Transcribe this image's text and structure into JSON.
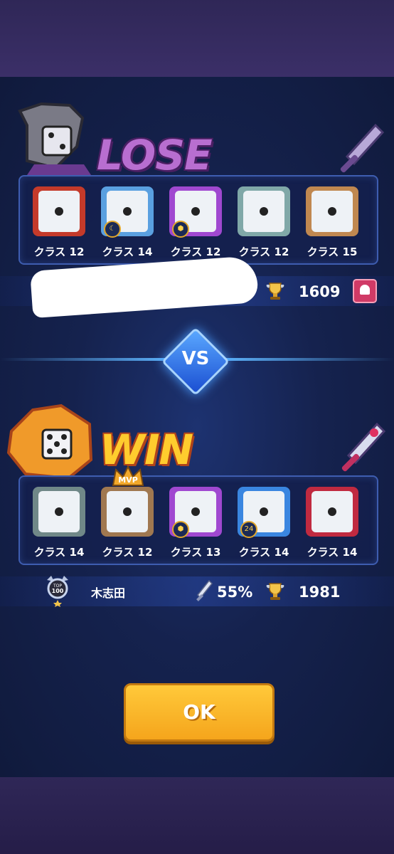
{
  "lose": {
    "banner": "LOSE",
    "dice": [
      {
        "label": "クラス 12",
        "icon": "sword-dice-icon",
        "color": "#c43a2a",
        "badge": ""
      },
      {
        "label": "クラス 14",
        "icon": "wind-dice-icon",
        "color": "#5aa0e0",
        "badge": "moon"
      },
      {
        "label": "クラス 12",
        "icon": "ring-dice-icon",
        "color": "#a048d0",
        "badge": "hex"
      },
      {
        "label": "クラス 12",
        "icon": "paper-dice-icon",
        "color": "#80a8a8",
        "badge": ""
      },
      {
        "label": "クラス 15",
        "icon": "mystery-dice-icon",
        "color": "#c08850",
        "badge": ""
      }
    ],
    "trophies": "1609"
  },
  "vs": "VS",
  "win": {
    "banner": "WIN",
    "mvp": "MVP",
    "dice": [
      {
        "label": "クラス 14",
        "icon": "checker-dice-icon",
        "color": "#708888",
        "badge": ""
      },
      {
        "label": "クラス 12",
        "icon": "castle-dice-icon",
        "color": "#a07850",
        "badge": ""
      },
      {
        "label": "クラス 13",
        "icon": "ring-dice-icon",
        "color": "#a048d0",
        "badge": "hex"
      },
      {
        "label": "クラス 14",
        "icon": "wind-dice-icon",
        "color": "#3a86e0",
        "badge": "24"
      },
      {
        "label": "クラス 14",
        "icon": "target-dice-icon",
        "color": "#c02a40",
        "badge": ""
      }
    ],
    "rank_badge": "TOP 100",
    "player_name": "木志田",
    "crit_percent": "55%",
    "trophies": "1981"
  },
  "ok_button": "OK"
}
